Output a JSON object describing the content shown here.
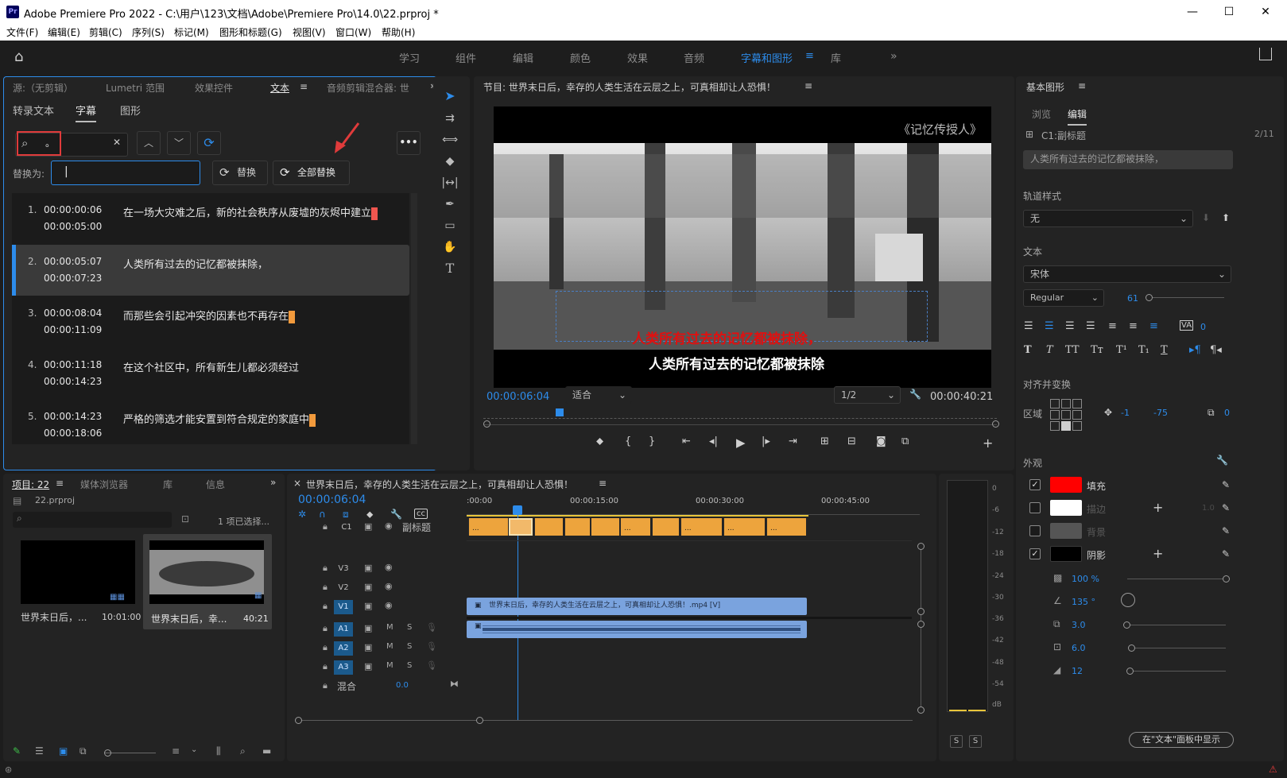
{
  "window": {
    "title": "Adobe Premiere Pro 2022 - C:\\用户\\123\\文档\\Adobe\\Premiere Pro\\14.0\\22.prproj *",
    "app_icon": "Pr"
  },
  "menu": [
    "文件(F)",
    "编辑(E)",
    "剪辑(C)",
    "序列(S)",
    "标记(M)",
    "图形和标题(G)",
    "视图(V)",
    "窗口(W)",
    "帮助(H)"
  ],
  "workspaces": [
    "学习",
    "组件",
    "编辑",
    "颜色",
    "效果",
    "音频",
    "字幕和图形",
    "库"
  ],
  "active_workspace": "字幕和图形",
  "left_panel": {
    "tabs": [
      "源:（无剪辑）",
      "Lumetri 范围",
      "效果控件",
      "文本",
      "音频剪辑混合器: 世"
    ],
    "active_tab": "文本",
    "subtabs": [
      "转录文本",
      "字幕",
      "图形"
    ],
    "active_subtab": "字幕",
    "search_value": "。",
    "replace_label": "替换为:",
    "replace_value": "",
    "replace_button": "替换",
    "replace_all_button": "全部替换",
    "captions": [
      {
        "n": "1.",
        "in": "00:00:00:06",
        "out": "00:00:05:00",
        "text": "在一场大灾难之后，新的社会秩序从废墟的灰烬中建立"
      },
      {
        "n": "2.",
        "in": "00:00:05:07",
        "out": "00:00:07:23",
        "text": "人类所有过去的记忆都被抹除，"
      },
      {
        "n": "3.",
        "in": "00:00:08:04",
        "out": "00:00:11:09",
        "text": "而那些会引起冲突的因素也不再存在"
      },
      {
        "n": "4.",
        "in": "00:00:11:18",
        "out": "00:00:14:23",
        "text": "在这个社区中，所有新生儿都必须经过"
      },
      {
        "n": "5.",
        "in": "00:00:14:23",
        "out": "00:00:18:06",
        "text": "严格的筛选才能安置到符合规定的家庭中"
      }
    ]
  },
  "program": {
    "title": "节目: 世界末日后，幸存的人类生活在云层之上，可真相却让人恐惧！",
    "watermark": "《记忆传授人》",
    "subtitle_red": "人类所有过去的记忆都被抹除，",
    "subtitle_white": "人类所有过去的记忆都被抹除",
    "timecode": "00:00:06:04",
    "fit": "适合",
    "resolution": "1/2",
    "duration": "00:00:40:21"
  },
  "project": {
    "tabs": [
      "项目: 22",
      "媒体浏览器",
      "库",
      "信息"
    ],
    "file": "22.prproj",
    "selected": "1 项已选择...",
    "items": [
      {
        "name": "世界末日后，...",
        "dur": "10:01:00"
      },
      {
        "name": "世界末日后，幸...",
        "dur": "40:21"
      }
    ]
  },
  "timeline": {
    "title": "世界末日后，幸存的人类生活在云层之上，可真相却让人恐惧！",
    "timecode": "00:00:06:04",
    "ruler": [
      ":00:00",
      "00:00:15:00",
      "00:00:30:00",
      "00:00:45:00"
    ],
    "caption_track": "C1",
    "caption_track_name": "副标题",
    "video_tracks": [
      "V3",
      "V2",
      "V1"
    ],
    "audio_tracks": [
      "A1",
      "A2",
      "A3"
    ],
    "mix_label": "混合",
    "mix_value": "0.0",
    "video_clip": "世界末日后，幸存的人类生活在云层之上，可真相却让人恐惧！.mp4 [V]",
    "clip_mark": "...",
    "mute": "M",
    "solo": "S"
  },
  "meter": {
    "scale": [
      "0",
      "-6",
      "-12",
      "-18",
      "-24",
      "-30",
      "-36",
      "-42",
      "-48",
      "-54",
      "dB"
    ],
    "buttons": [
      "S",
      "S"
    ]
  },
  "essential_graphics": {
    "title": "基本图形",
    "tabs": [
      "浏览",
      "编辑"
    ],
    "active_tab": "编辑",
    "layer": "C1:副标题",
    "layer_count": "2/11",
    "text_value": "人类所有过去的记忆都被抹除，",
    "track_style_label": "轨道样式",
    "track_style": "无",
    "text_label": "文本",
    "font": "宋体",
    "font_style": "Regular",
    "font_size": "61",
    "tracking": "0",
    "align_label": "对齐并变换",
    "region_label": "区域",
    "pos_x": "-1",
    "pos_y": "-75",
    "scale_val": "0",
    "appearance_label": "外观",
    "fill_label": "填充",
    "stroke_label": "描边",
    "bg_label": "背景",
    "shadow_label": "阴影",
    "stroke_width": "1.0",
    "opacity": "100 %",
    "angle": "135 °",
    "distance": "3.0",
    "size": "6.0",
    "blur": "12",
    "show_in_text_button": "在\"文本\"面板中显示",
    "fill_color": "#ff0000",
    "stroke_color": "#ffffff",
    "shadow_color": "#000000"
  }
}
